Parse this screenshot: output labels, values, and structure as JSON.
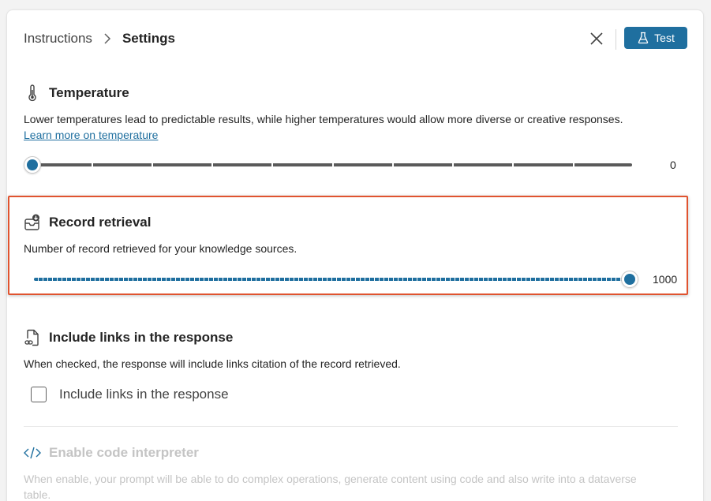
{
  "breadcrumb": {
    "parent": "Instructions",
    "current": "Settings"
  },
  "header": {
    "test_label": "Test"
  },
  "temperature": {
    "title": "Temperature",
    "description": "Lower temperatures lead to predictable results, while higher temperatures would allow more diverse or creative responses.",
    "link_text": "Learn more on temperature",
    "value": "0",
    "value_fraction": 0
  },
  "record_retrieval": {
    "title": "Record retrieval",
    "description": "Number of record retrieved for your knowledge sources.",
    "value": "1000",
    "value_fraction": 1
  },
  "include_links": {
    "title": "Include links in the response",
    "description": "When checked, the response will include links citation of the record retrieved.",
    "checkbox_label": "Include links in the response",
    "checked": false
  },
  "code_interpreter": {
    "title": "Enable code interpreter",
    "description": "When enable, your prompt will be able to do complex operations, generate content using code and also write into a dataverse table.",
    "disabled": true
  },
  "colors": {
    "accent": "#1f6f9f",
    "highlight_border": "#e0532f",
    "disabled_text": "#c4c4c4"
  }
}
